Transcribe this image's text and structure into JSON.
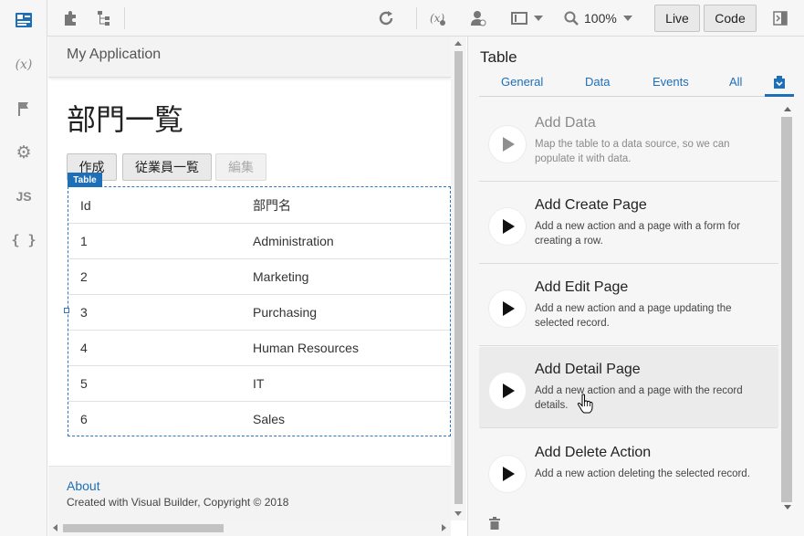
{
  "activity_bar": {
    "items": [
      {
        "name": "page-structure-icon",
        "glyph": ""
      },
      {
        "name": "variables-icon",
        "glyph": "(x)"
      },
      {
        "name": "flag-icon",
        "glyph": ""
      },
      {
        "name": "settings-gear-icon",
        "glyph": "⚙"
      },
      {
        "name": "javascript-icon",
        "glyph": "JS"
      },
      {
        "name": "json-braces-icon",
        "glyph": "{ }"
      }
    ]
  },
  "toolbar": {
    "zoom": "100%",
    "live_label": "Live",
    "code_label": "Code"
  },
  "canvas": {
    "app_title": "My Application",
    "page_heading": "部門一覧",
    "buttons": [
      "作成",
      "従業員一覧",
      "編集"
    ],
    "table_badge": "Table",
    "table": {
      "columns": [
        "Id",
        "部門名"
      ],
      "rows": [
        [
          "1",
          "Administration"
        ],
        [
          "2",
          "Marketing"
        ],
        [
          "3",
          "Purchasing"
        ],
        [
          "4",
          "Human Resources"
        ],
        [
          "5",
          "IT"
        ],
        [
          "6",
          "Sales"
        ]
      ]
    },
    "footer": {
      "link": "About",
      "copyright": "Created with Visual Builder, Copyright © 2018"
    }
  },
  "panel": {
    "title": "Table",
    "tabs": [
      "General",
      "Data",
      "Events",
      "All"
    ],
    "quick_starts": [
      {
        "title": "Add Data",
        "desc": "Map the table to a data source, so we can populate it with data."
      },
      {
        "title": "Add Create Page",
        "desc": "Add a new action and a page with a form for creating a row."
      },
      {
        "title": "Add Edit Page",
        "desc": "Add a new action and a page updating the selected record."
      },
      {
        "title": "Add Detail Page",
        "desc": "Add a new action and a page with the record details."
      },
      {
        "title": "Add Delete Action",
        "desc": "Add a new action deleting the selected record."
      }
    ]
  },
  "colors": {
    "accent": "#1d6fb8",
    "toolbar_bg": "#f6f6f6"
  }
}
